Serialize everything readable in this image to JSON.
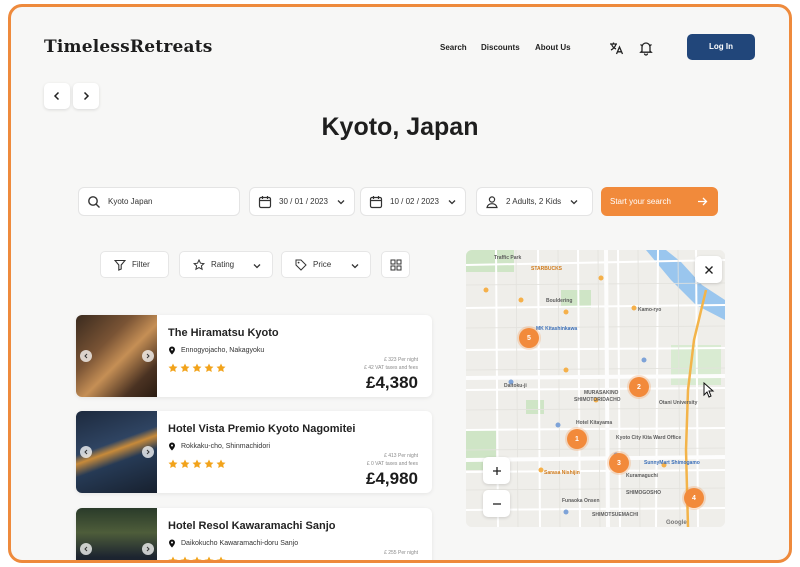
{
  "header": {
    "logo": "TimelessRetreats",
    "nav": [
      "Search",
      "Discounts",
      "About Us"
    ],
    "login_label": "Log In",
    "icons": [
      "translate-icon",
      "notification-bell-icon"
    ]
  },
  "page_title": "Kyoto, Japan",
  "search": {
    "location": "Kyoto Japan",
    "checkin": "30 / 01 / 2023",
    "checkout": "10 / 02 / 2023",
    "guests": "2 Adults, 2 Kids",
    "submit_label": "Start your search"
  },
  "filters": {
    "filter_label": "Filter",
    "rating_label": "Rating",
    "price_label": "Price"
  },
  "hotels": [
    {
      "name": "The Hiramatsu Kyoto",
      "location": "Ennogyojacho, Nakagyoku",
      "stars": 5,
      "per_night": "£ 323 Per night",
      "vat": "£ 42 VAT taxes and fees",
      "price": "£4,380"
    },
    {
      "name": "Hotel Vista Premio Kyoto Nagomitei",
      "location": "Rokkaku-cho, Shinmachidori",
      "stars": 5,
      "per_night": "£ 413 Per night",
      "vat": "£ 0 VAT taxes and fees",
      "price": "£4,980"
    },
    {
      "name": "Hotel Resol Kawaramachi Sanjo",
      "location": "Daikokucho Kawaramachi-doru Sanjo",
      "stars": 5,
      "per_night": "£ 255 Per night",
      "vat": "",
      "price": ""
    }
  ],
  "map": {
    "clusters": [
      "5",
      "2",
      "1",
      "3",
      "4"
    ],
    "labels": {
      "traffic": "Traffic Park",
      "starbucks": "STARBUCKS",
      "bouldering": "Bouldering",
      "kamo": "Kamo-ryo",
      "mk": "MK Kitashinkawa",
      "daitoku": "Daitoku-ji",
      "murasakino": "MURASAKINO",
      "shimoto": "SHIMOTORIDACHO",
      "hotel": "Hotel Kitayama",
      "otani": "Otani University",
      "kyoto_city": "Kyoto City Kita Ward Office",
      "sunnymart": "SunnyMart Shimogamo",
      "sarasa": "Sarasa Nishijin",
      "shimogoshun": "SHIMOGOSHO",
      "kuramaguchi": "Kuramaguchi",
      "funaoka": "Funaoka Onsen",
      "shimotera": "SHIMOTSUEMACHI",
      "google": "Google"
    }
  },
  "colors": {
    "accent": "#f18a3b",
    "brand": "#21467a",
    "star": "#f2a31b",
    "frame": "#ee8a3c"
  }
}
